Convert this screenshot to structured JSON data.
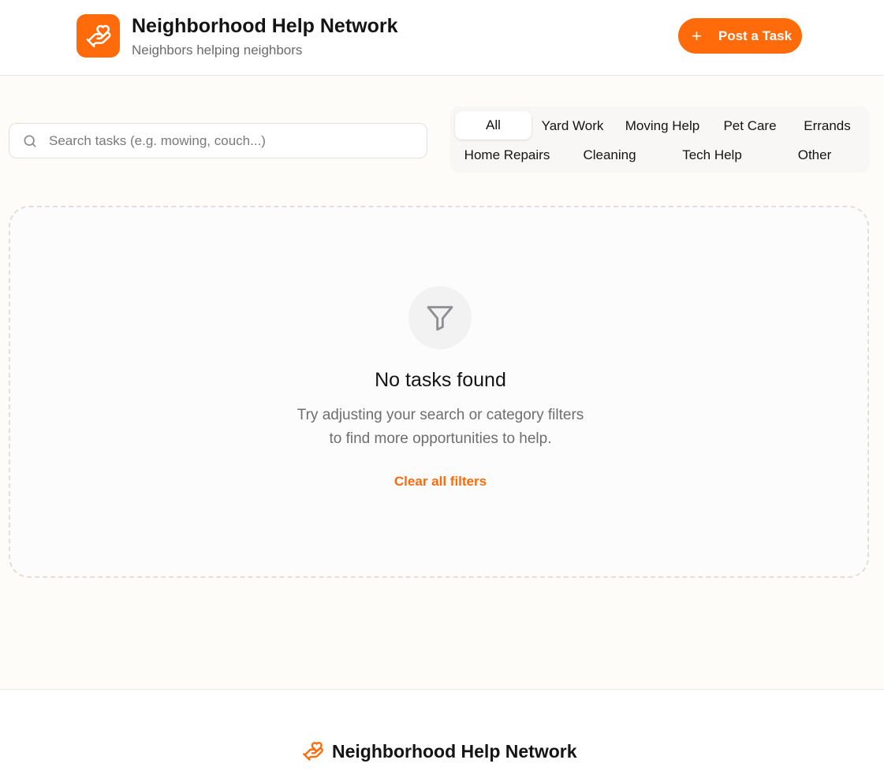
{
  "header": {
    "title": "Neighborhood Help Network",
    "subtitle": "Neighbors helping neighbors",
    "post_button_label": "Post a Task",
    "logo_icon": "hand-heart-icon"
  },
  "search": {
    "placeholder": "Search tasks (e.g. mowing, couch...)",
    "value": "",
    "icon": "search-icon"
  },
  "categories": {
    "active": "All",
    "items": [
      {
        "label": "All"
      },
      {
        "label": "Yard Work"
      },
      {
        "label": "Moving Help"
      },
      {
        "label": "Pet Care"
      },
      {
        "label": "Errands"
      },
      {
        "label": "Home Repairs"
      },
      {
        "label": "Cleaning"
      },
      {
        "label": "Tech Help"
      },
      {
        "label": "Other"
      }
    ]
  },
  "empty_state": {
    "icon": "filter-icon",
    "title": "No tasks found",
    "line1": "Try adjusting your search or category filters",
    "line2": "to find more opportunities to help.",
    "clear_label": "Clear all filters"
  },
  "footer": {
    "title": "Neighborhood Help Network",
    "icon": "hand-heart-icon"
  },
  "colors": {
    "accent": "#ff6a0a",
    "background": "#fdfcf9",
    "text": "#141414",
    "muted": "#6e6e6e"
  }
}
